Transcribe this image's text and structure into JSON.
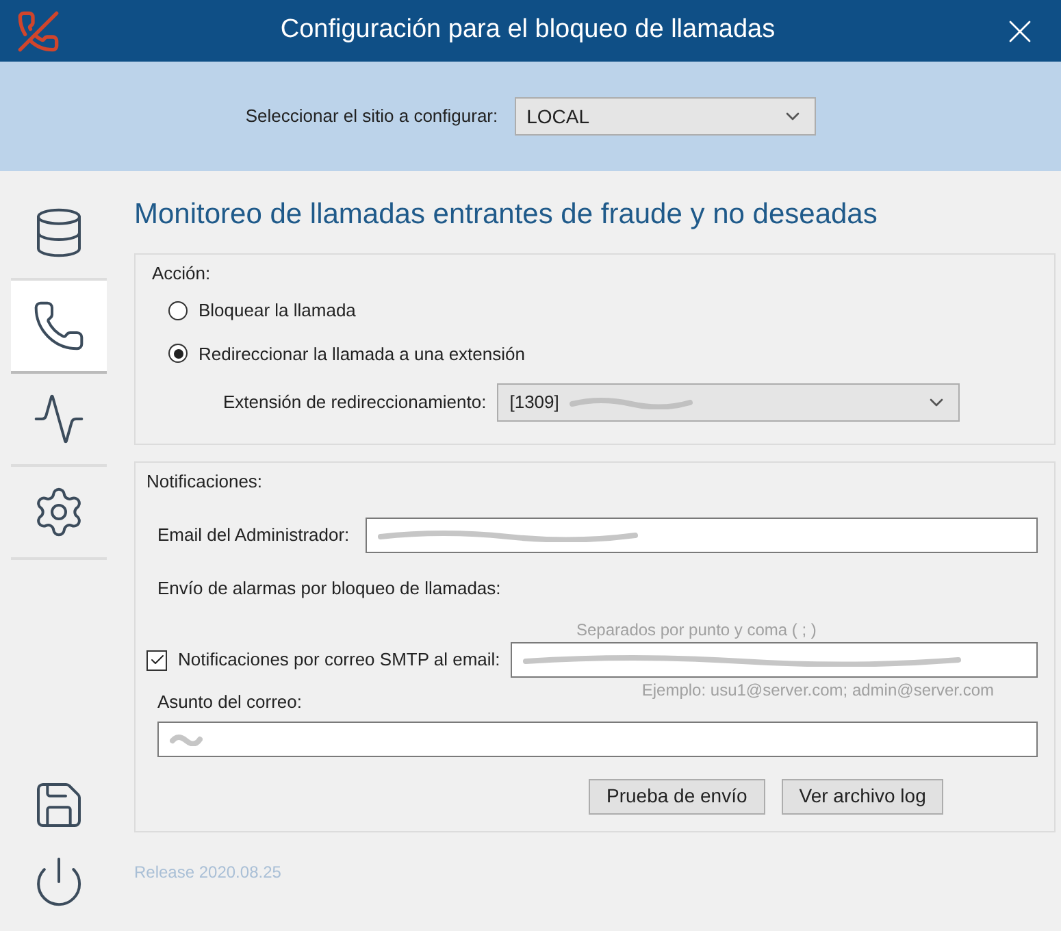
{
  "window": {
    "title": "Configuración para el bloqueo de llamadas"
  },
  "site_selector": {
    "label": "Seleccionar el sitio a configurar:",
    "value": "LOCAL"
  },
  "sidebar": {
    "tabs": [
      {
        "kind": "database",
        "selected": false
      },
      {
        "kind": "phone",
        "selected": true
      },
      {
        "kind": "monitor",
        "selected": false
      },
      {
        "kind": "gears",
        "selected": false
      }
    ],
    "actions": [
      {
        "kind": "save"
      },
      {
        "kind": "power"
      }
    ]
  },
  "heading": "Monitoreo de llamadas entrantes de fraude y no deseadas",
  "action_group": {
    "title": "Acción:",
    "options": [
      {
        "label": "Bloquear la llamada",
        "selected": false
      },
      {
        "label": "Redireccionar la llamada a una extensión",
        "selected": true
      }
    ],
    "redirect": {
      "label": "Extensión de redireccionamiento:",
      "value": "[1309]",
      "redacted": true
    }
  },
  "notifications": {
    "title": "Notificaciones:",
    "admin_email": {
      "label": "Email del Administrador:",
      "redacted": true
    },
    "alarms_label": "Envío de alarmas por bloqueo de llamadas:",
    "hint_top": "Separados por punto y coma ( ; )",
    "smtp": {
      "label": "Notificaciones por correo SMTP al email:",
      "checked": true,
      "redacted": true
    },
    "hint_bottom": "Ejemplo: usu1@server.com; admin@server.com",
    "subject": {
      "label": "Asunto del correo:",
      "redacted": true
    },
    "buttons": [
      "Prueba de envío",
      "Ver archivo log"
    ]
  },
  "footer": {
    "release": "Release 2020.08.25"
  }
}
